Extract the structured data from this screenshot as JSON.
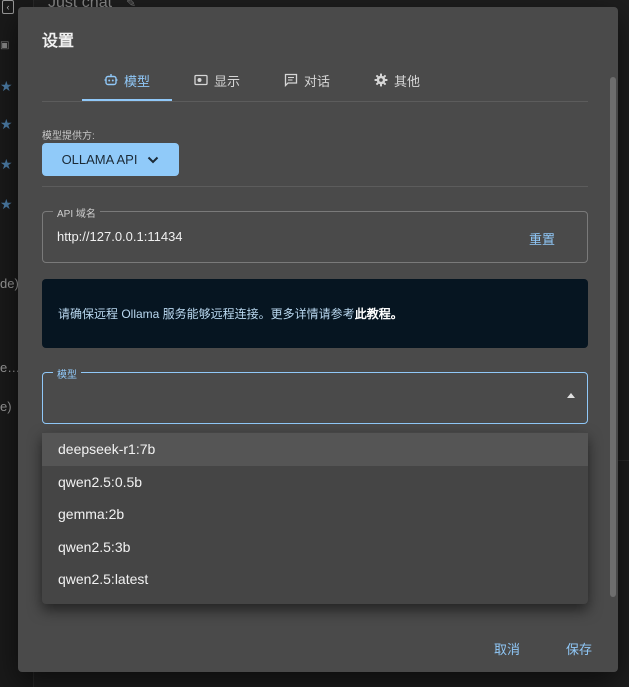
{
  "background": {
    "title": "Just chat",
    "side_texts": [
      "de)",
      "e…",
      "e)"
    ]
  },
  "dialog": {
    "title": "设置",
    "tabs": [
      {
        "label": "模型",
        "icon": "robot-icon",
        "active": true
      },
      {
        "label": "显示",
        "icon": "display-icon",
        "active": false
      },
      {
        "label": "对话",
        "icon": "chat-icon",
        "active": false
      },
      {
        "label": "其他",
        "icon": "gear-icon",
        "active": false
      }
    ],
    "provider": {
      "label": "模型提供方:",
      "value": "OLLAMA API"
    },
    "api": {
      "label": "API 域名",
      "value": "http://127.0.0.1:11434",
      "reset_label": "重置"
    },
    "info": {
      "text": "请确保远程 Ollama 服务能够远程连接。更多详情请参考",
      "link_text": "此教程",
      "suffix": "。"
    },
    "model": {
      "label": "模型",
      "value": "",
      "options": [
        "deepseek-r1:7b",
        "qwen2.5:0.5b",
        "gemma:2b",
        "qwen2.5:3b",
        "qwen2.5:latest"
      ],
      "hovered_index": 0
    },
    "footer": {
      "cancel_label": "取消",
      "save_label": "保存"
    }
  },
  "colors": {
    "accent": "#90caf9",
    "dialog_bg": "#4a4a4a",
    "info_bg": "#061521"
  }
}
